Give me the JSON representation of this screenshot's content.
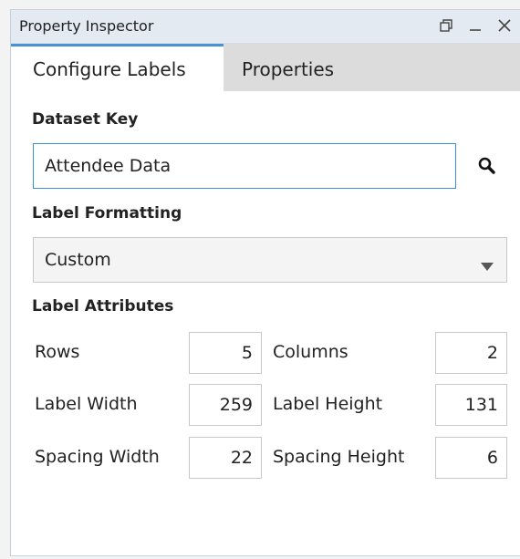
{
  "window": {
    "title": "Property Inspector",
    "icons": [
      "restore-icon",
      "minimize-icon",
      "close-icon"
    ]
  },
  "tabs": [
    {
      "label": "Configure Labels",
      "active": true
    },
    {
      "label": "Properties",
      "active": false
    }
  ],
  "dataset_key": {
    "heading": "Dataset Key",
    "value": "Attendee Data",
    "search_icon": "search-icon"
  },
  "label_formatting": {
    "heading": "Label Formatting",
    "selected": "Custom"
  },
  "label_attributes": {
    "heading": "Label Attributes",
    "rows_label": "Rows",
    "rows_value": "5",
    "columns_label": "Columns",
    "columns_value": "2",
    "label_width_label": "Label Width",
    "label_width_value": "259",
    "label_height_label": "Label Height",
    "label_height_value": "131",
    "spacing_width_label": "Spacing Width",
    "spacing_width_value": "22",
    "spacing_height_label": "Spacing Height",
    "spacing_height_value": "6"
  },
  "colors": {
    "accent": "#4a90d6",
    "titlebar": "#e3eaf1",
    "inactive_tab": "#dcdcdc"
  }
}
